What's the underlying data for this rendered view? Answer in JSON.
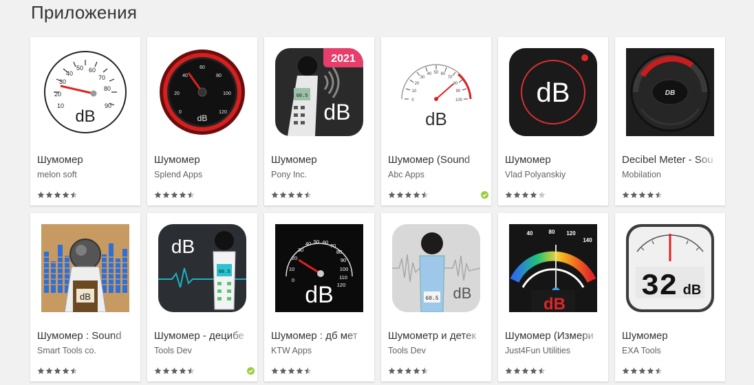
{
  "section_title": "Приложения",
  "colors": {
    "star_fill": "#616161",
    "star_empty": "#c8c8c8",
    "editor_badge": "#9ccc3c"
  },
  "apps": [
    {
      "title": "Шумомер",
      "developer": "melon soft",
      "rating": 4.5,
      "editors_choice": false,
      "icon": "analog-gauge-db-icon"
    },
    {
      "title": "Шумомер",
      "developer": "Splend Apps",
      "rating": 4.5,
      "editors_choice": false,
      "icon": "red-ring-gauge-icon"
    },
    {
      "title": "Шумомер",
      "developer": "Pony Inc.",
      "rating": 4.5,
      "editors_choice": false,
      "icon": "sound-meter-2021-icon",
      "icon_badge": "2021"
    },
    {
      "title": "Шумомер (Sound",
      "developer": "Abc Apps",
      "rating": 4.5,
      "editors_choice": true,
      "icon": "speedometer-db-icon"
    },
    {
      "title": "Шумомер",
      "developer": "Vlad Polyanskiy",
      "rating": 4.0,
      "editors_choice": false,
      "icon": "dark-db-circle-icon"
    },
    {
      "title": "Decibel Meter - Sou",
      "developer": "Mobilation",
      "rating": 4.5,
      "editors_choice": false,
      "icon": "dark-arc-gauge-icon"
    },
    {
      "title": "Шумомер : Sound",
      "developer": "Smart Tools co.",
      "rating": 4.5,
      "editors_choice": false,
      "icon": "equalizer-meter-icon"
    },
    {
      "title": "Шумомер - децибе",
      "developer": "Tools Dev",
      "rating": 4.5,
      "editors_choice": true,
      "icon": "db-waveform-meter-icon"
    },
    {
      "title": "Шумомер : дб мет",
      "developer": "KTW Apps",
      "rating": 4.5,
      "editors_choice": false,
      "icon": "black-gauge-db-icon"
    },
    {
      "title": "Шумометр и детек",
      "developer": "Tools Dev",
      "rating": 4.5,
      "editors_choice": false,
      "icon": "grey-meter-db-icon"
    },
    {
      "title": "Шумомер (Измери",
      "developer": "Just4Fun Utilities",
      "rating": 4.5,
      "editors_choice": false,
      "icon": "colorful-gauge-db-icon"
    },
    {
      "title": "Шумомер",
      "developer": "EXA Tools",
      "rating": 4.5,
      "editors_choice": false,
      "icon": "lcd-32db-icon"
    }
  ],
  "icon_text": {
    "db": "dB",
    "db_caps": "DB",
    "lcd_value": "32",
    "lcd_unit": "dB",
    "meter_reading": "60.5",
    "gauge1_ticks": [
      "10",
      "20",
      "30",
      "40",
      "50",
      "60",
      "70",
      "80",
      "90"
    ],
    "gauge2_ticks": [
      "0",
      "20",
      "40",
      "60",
      "80",
      "100",
      "120"
    ],
    "gauge4_ticks": [
      "0",
      "10",
      "20",
      "30",
      "40",
      "50",
      "60",
      "70",
      "80",
      "90",
      "100"
    ],
    "gauge9_ticks": [
      "0",
      "10",
      "20",
      "30",
      "40",
      "50",
      "60",
      "70",
      "80",
      "90",
      "100",
      "110",
      "120"
    ],
    "gauge11_ticks": [
      "40",
      "80",
      "120",
      "140"
    ]
  }
}
